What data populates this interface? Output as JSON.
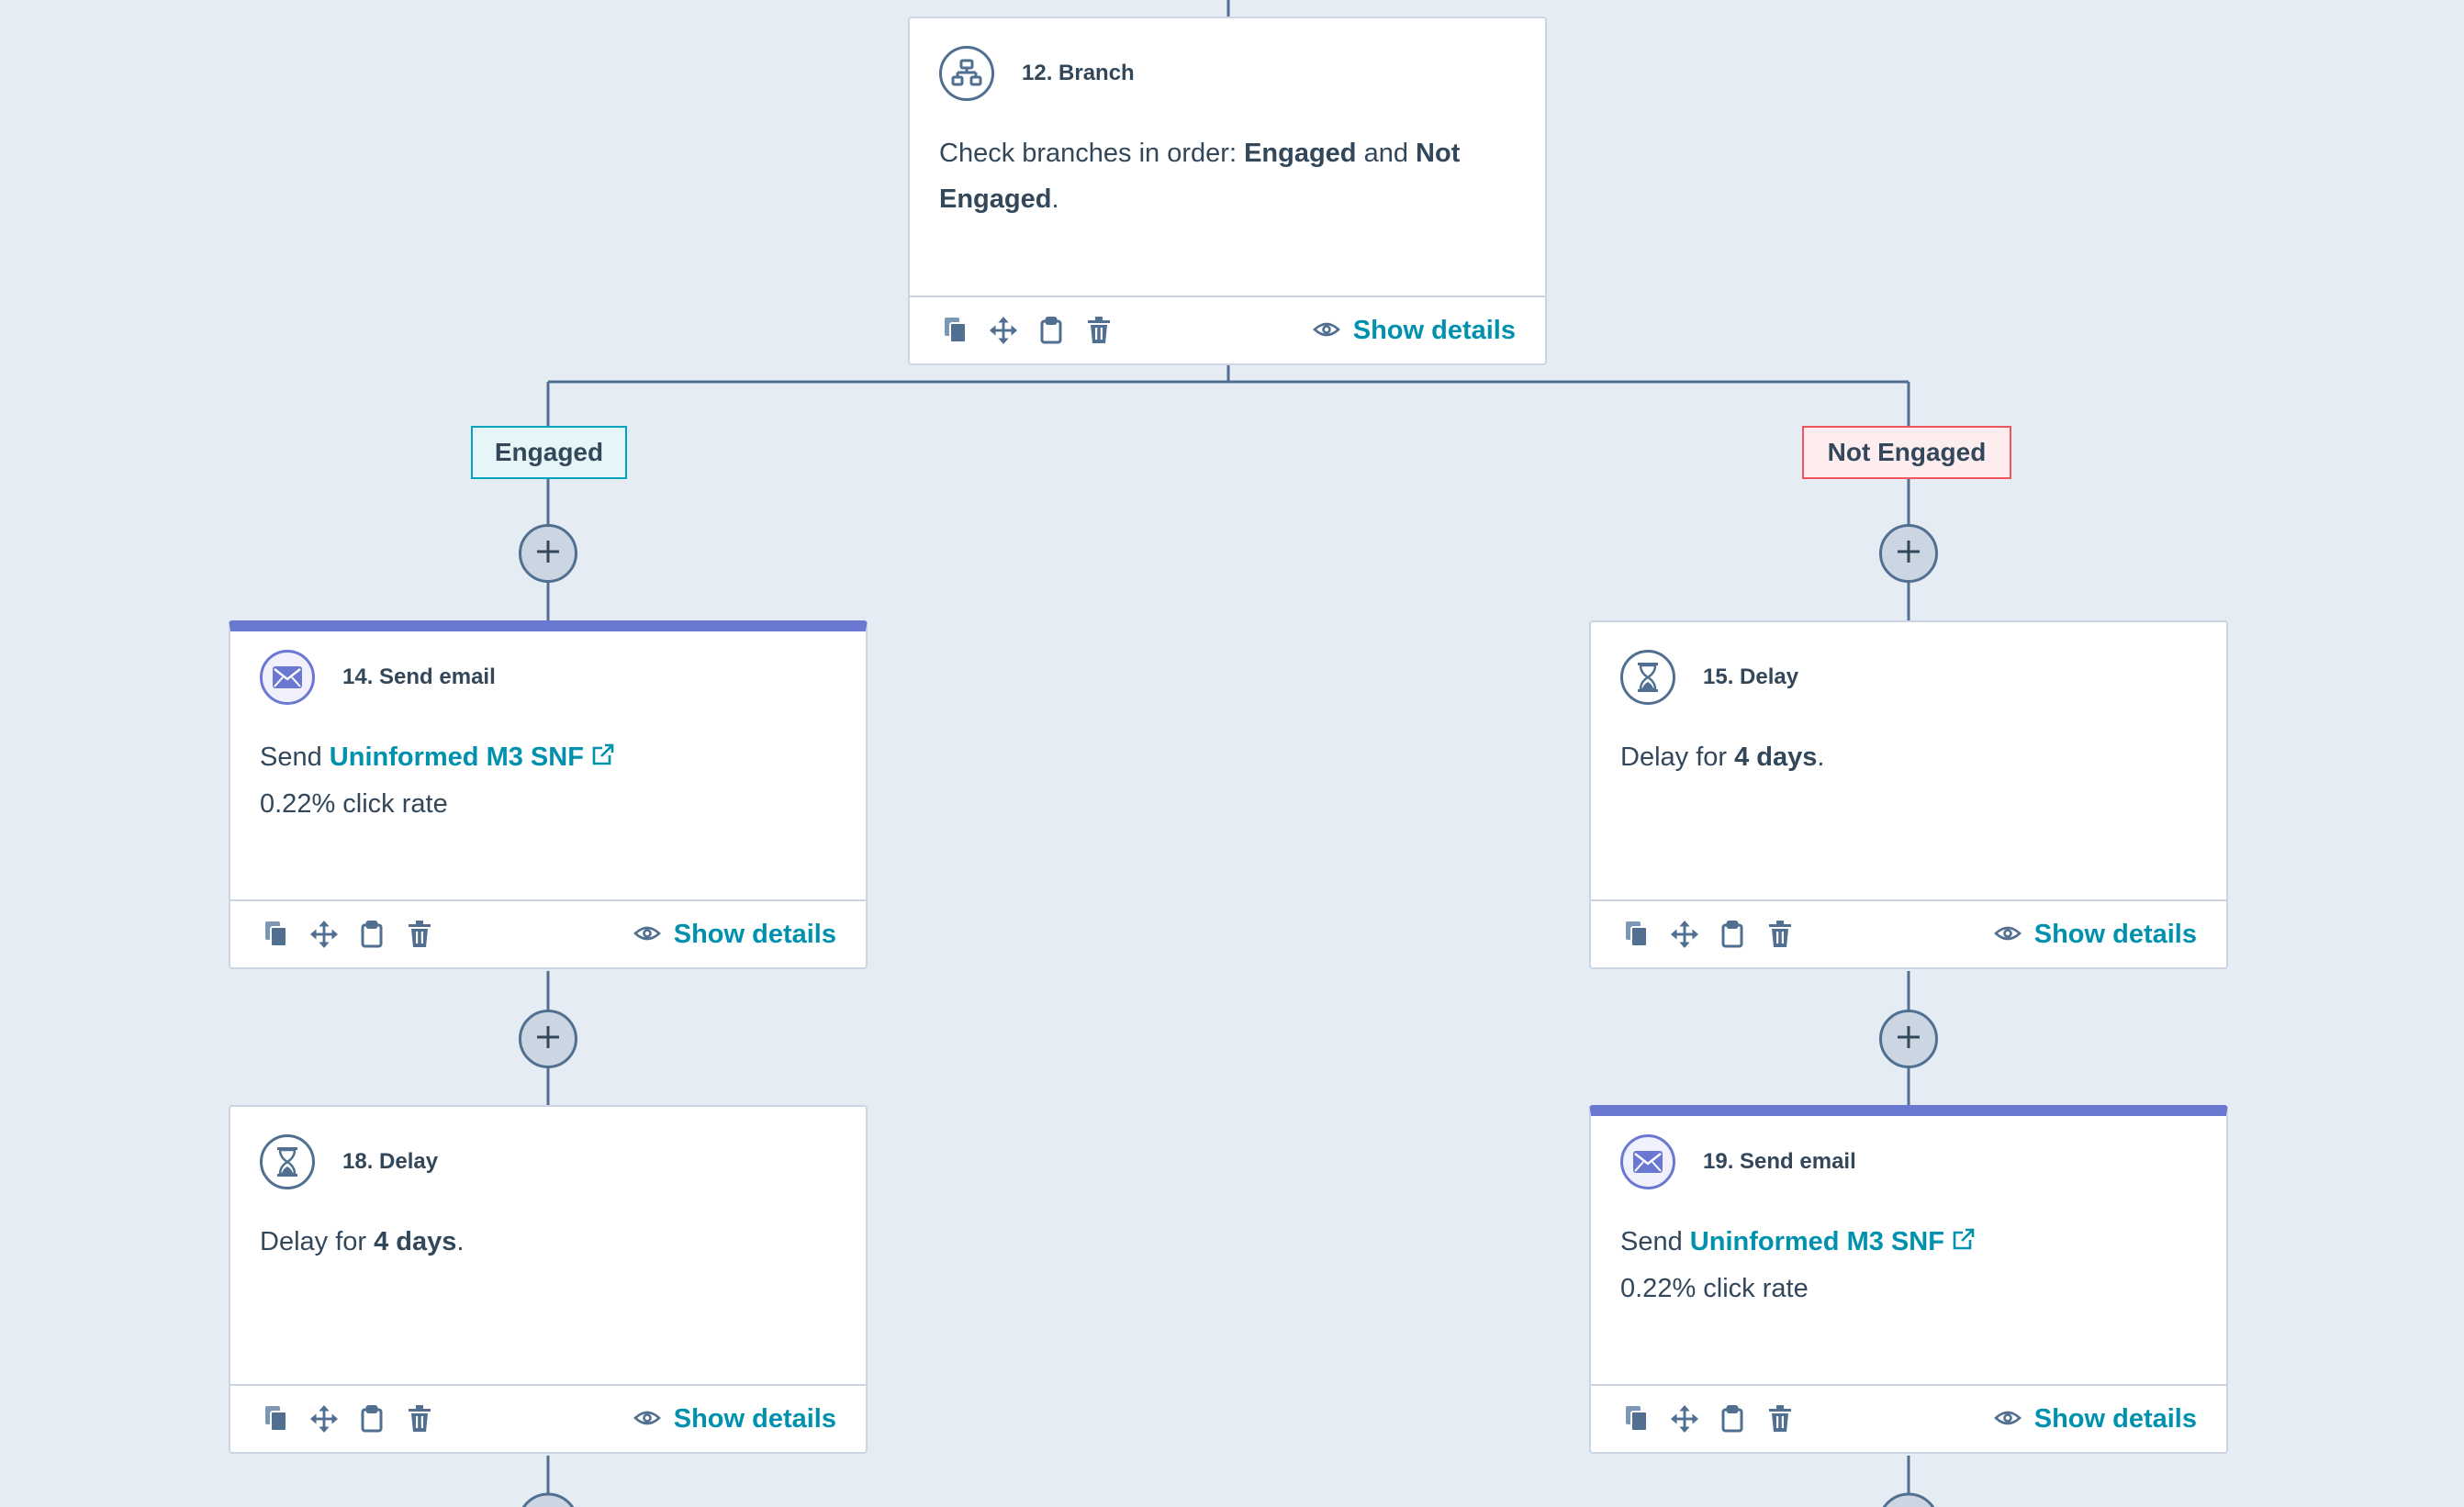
{
  "colors": {
    "background": "#e6ecf4",
    "connector": "#516f90",
    "link": "#0091ae",
    "email_accent": "#6a78d1",
    "engaged_border": "#00a4bd",
    "not_engaged_border": "#f2545b"
  },
  "cards": {
    "branch": {
      "icon": "branch-icon",
      "title": "12. Branch",
      "text_prefix": "Check branches in order: ",
      "branch_a": "Engaged",
      "text_mid": " and ",
      "branch_b": "Not Engaged",
      "text_suffix": ".",
      "show_details": "Show details"
    },
    "email_14": {
      "icon": "envelope-icon",
      "title": "14. Send email",
      "send_prefix": "Send ",
      "email_name": "Uninformed M3 SNF",
      "click_rate": "0.22% click rate",
      "show_details": "Show details"
    },
    "delay_15": {
      "icon": "hourglass-icon",
      "title": "15. Delay",
      "text_prefix": "Delay for ",
      "duration": "4 days",
      "text_suffix": ".",
      "show_details": "Show details"
    },
    "delay_18": {
      "icon": "hourglass-icon",
      "title": "18. Delay",
      "text_prefix": "Delay for ",
      "duration": "4 days",
      "text_suffix": ".",
      "show_details": "Show details"
    },
    "email_19": {
      "icon": "envelope-icon",
      "title": "19. Send email",
      "send_prefix": "Send ",
      "email_name": "Uninformed M3 SNF",
      "click_rate": "0.22% click rate",
      "show_details": "Show details"
    }
  },
  "branches": {
    "left": "Engaged",
    "right": "Not Engaged"
  },
  "toolbar_icons": [
    "copy-icon",
    "move-icon",
    "clipboard-icon",
    "trash-icon"
  ]
}
